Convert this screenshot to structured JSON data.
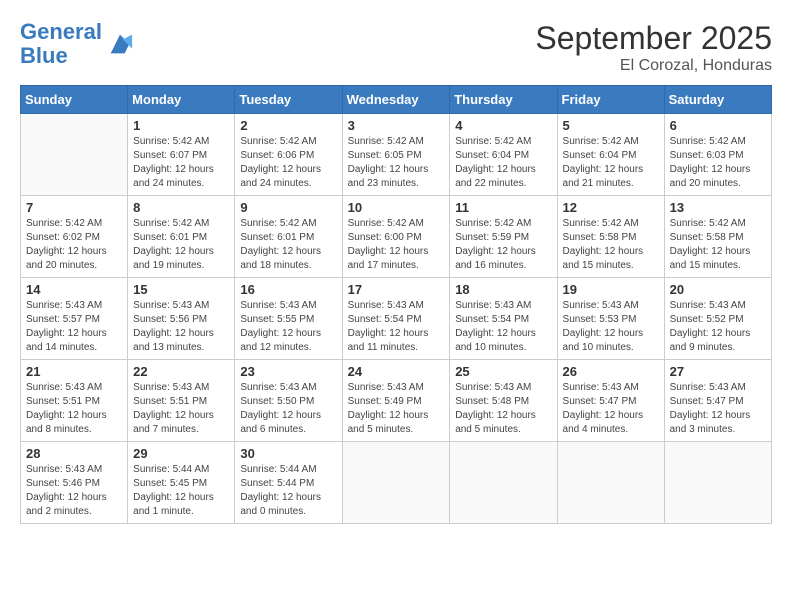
{
  "header": {
    "logo_line1": "General",
    "logo_line2": "Blue",
    "month_title": "September 2025",
    "subtitle": "El Corozal, Honduras"
  },
  "weekdays": [
    "Sunday",
    "Monday",
    "Tuesday",
    "Wednesday",
    "Thursday",
    "Friday",
    "Saturday"
  ],
  "weeks": [
    [
      {
        "day": "",
        "info": ""
      },
      {
        "day": "1",
        "info": "Sunrise: 5:42 AM\nSunset: 6:07 PM\nDaylight: 12 hours\nand 24 minutes."
      },
      {
        "day": "2",
        "info": "Sunrise: 5:42 AM\nSunset: 6:06 PM\nDaylight: 12 hours\nand 24 minutes."
      },
      {
        "day": "3",
        "info": "Sunrise: 5:42 AM\nSunset: 6:05 PM\nDaylight: 12 hours\nand 23 minutes."
      },
      {
        "day": "4",
        "info": "Sunrise: 5:42 AM\nSunset: 6:04 PM\nDaylight: 12 hours\nand 22 minutes."
      },
      {
        "day": "5",
        "info": "Sunrise: 5:42 AM\nSunset: 6:04 PM\nDaylight: 12 hours\nand 21 minutes."
      },
      {
        "day": "6",
        "info": "Sunrise: 5:42 AM\nSunset: 6:03 PM\nDaylight: 12 hours\nand 20 minutes."
      }
    ],
    [
      {
        "day": "7",
        "info": "Sunrise: 5:42 AM\nSunset: 6:02 PM\nDaylight: 12 hours\nand 20 minutes."
      },
      {
        "day": "8",
        "info": "Sunrise: 5:42 AM\nSunset: 6:01 PM\nDaylight: 12 hours\nand 19 minutes."
      },
      {
        "day": "9",
        "info": "Sunrise: 5:42 AM\nSunset: 6:01 PM\nDaylight: 12 hours\nand 18 minutes."
      },
      {
        "day": "10",
        "info": "Sunrise: 5:42 AM\nSunset: 6:00 PM\nDaylight: 12 hours\nand 17 minutes."
      },
      {
        "day": "11",
        "info": "Sunrise: 5:42 AM\nSunset: 5:59 PM\nDaylight: 12 hours\nand 16 minutes."
      },
      {
        "day": "12",
        "info": "Sunrise: 5:42 AM\nSunset: 5:58 PM\nDaylight: 12 hours\nand 15 minutes."
      },
      {
        "day": "13",
        "info": "Sunrise: 5:42 AM\nSunset: 5:58 PM\nDaylight: 12 hours\nand 15 minutes."
      }
    ],
    [
      {
        "day": "14",
        "info": "Sunrise: 5:43 AM\nSunset: 5:57 PM\nDaylight: 12 hours\nand 14 minutes."
      },
      {
        "day": "15",
        "info": "Sunrise: 5:43 AM\nSunset: 5:56 PM\nDaylight: 12 hours\nand 13 minutes."
      },
      {
        "day": "16",
        "info": "Sunrise: 5:43 AM\nSunset: 5:55 PM\nDaylight: 12 hours\nand 12 minutes."
      },
      {
        "day": "17",
        "info": "Sunrise: 5:43 AM\nSunset: 5:54 PM\nDaylight: 12 hours\nand 11 minutes."
      },
      {
        "day": "18",
        "info": "Sunrise: 5:43 AM\nSunset: 5:54 PM\nDaylight: 12 hours\nand 10 minutes."
      },
      {
        "day": "19",
        "info": "Sunrise: 5:43 AM\nSunset: 5:53 PM\nDaylight: 12 hours\nand 10 minutes."
      },
      {
        "day": "20",
        "info": "Sunrise: 5:43 AM\nSunset: 5:52 PM\nDaylight: 12 hours\nand 9 minutes."
      }
    ],
    [
      {
        "day": "21",
        "info": "Sunrise: 5:43 AM\nSunset: 5:51 PM\nDaylight: 12 hours\nand 8 minutes."
      },
      {
        "day": "22",
        "info": "Sunrise: 5:43 AM\nSunset: 5:51 PM\nDaylight: 12 hours\nand 7 minutes."
      },
      {
        "day": "23",
        "info": "Sunrise: 5:43 AM\nSunset: 5:50 PM\nDaylight: 12 hours\nand 6 minutes."
      },
      {
        "day": "24",
        "info": "Sunrise: 5:43 AM\nSunset: 5:49 PM\nDaylight: 12 hours\nand 5 minutes."
      },
      {
        "day": "25",
        "info": "Sunrise: 5:43 AM\nSunset: 5:48 PM\nDaylight: 12 hours\nand 5 minutes."
      },
      {
        "day": "26",
        "info": "Sunrise: 5:43 AM\nSunset: 5:47 PM\nDaylight: 12 hours\nand 4 minutes."
      },
      {
        "day": "27",
        "info": "Sunrise: 5:43 AM\nSunset: 5:47 PM\nDaylight: 12 hours\nand 3 minutes."
      }
    ],
    [
      {
        "day": "28",
        "info": "Sunrise: 5:43 AM\nSunset: 5:46 PM\nDaylight: 12 hours\nand 2 minutes."
      },
      {
        "day": "29",
        "info": "Sunrise: 5:44 AM\nSunset: 5:45 PM\nDaylight: 12 hours\nand 1 minute."
      },
      {
        "day": "30",
        "info": "Sunrise: 5:44 AM\nSunset: 5:44 PM\nDaylight: 12 hours\nand 0 minutes."
      },
      {
        "day": "",
        "info": ""
      },
      {
        "day": "",
        "info": ""
      },
      {
        "day": "",
        "info": ""
      },
      {
        "day": "",
        "info": ""
      }
    ]
  ]
}
